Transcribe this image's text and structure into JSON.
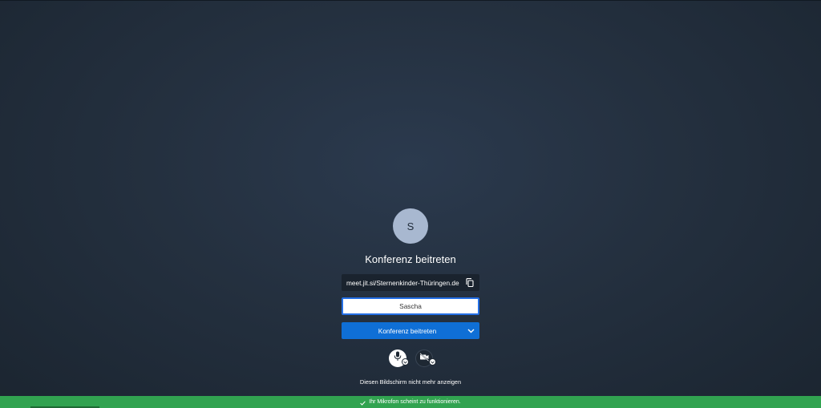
{
  "prejoin": {
    "avatar_initial": "S",
    "title": "Konferenz beitreten",
    "meeting_url": "meet.jit.si/Sternenkinder-Thüringen.de",
    "name_value": "Sascha",
    "join_label": "Konferenz beitreten",
    "dont_show_label": "Diesen Bildschirm nicht mehr anzeigen"
  },
  "status": {
    "text": "Ihr Mikrofon scheint zu funktionieren.",
    "state": "ok"
  },
  "icons": {
    "copy": "copy-icon",
    "join_options": "chevron-down-icon",
    "microphone": "microphone-icon",
    "camera": "camera-off-icon",
    "status": "checkmark-icon"
  },
  "colors": {
    "join_button": "#0f6fd6",
    "input_focus": "#246fe5",
    "status_ok": "#31a350",
    "avatar_bg": "#a8b8d0"
  }
}
